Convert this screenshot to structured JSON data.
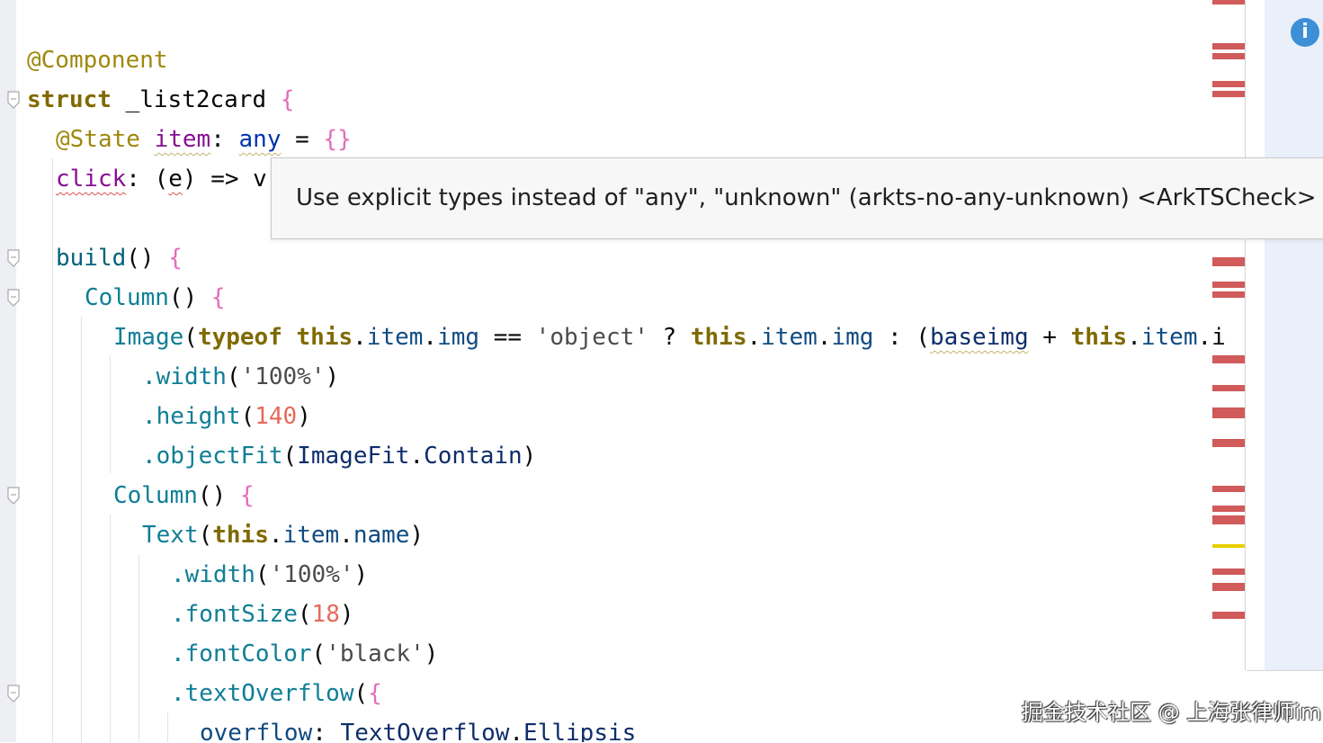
{
  "editor": {
    "lines": [
      {
        "id": "l1",
        "tokens": [
          {
            "c": "dec",
            "t": "@Component"
          }
        ]
      },
      {
        "id": "l2",
        "tokens": [
          {
            "c": "kw",
            "t": "struct"
          },
          {
            "c": "pn",
            "t": " _list2card "
          },
          {
            "c": "br",
            "t": "{"
          }
        ]
      },
      {
        "id": "l3",
        "tokens": [
          {
            "c": "dec",
            "t": "@State"
          },
          {
            "c": "pn",
            "t": " "
          },
          {
            "c": "pr wavy",
            "t": "item"
          },
          {
            "c": "pn",
            "t": ": "
          },
          {
            "c": "k wavy",
            "t": "any"
          },
          {
            "c": "pn",
            "t": " = "
          },
          {
            "c": "br",
            "t": "{}"
          }
        ]
      },
      {
        "id": "l4",
        "tokens": [
          {
            "c": "pr wavyr",
            "t": "click"
          },
          {
            "c": "pn",
            "t": ": ("
          },
          {
            "c": "pn wavyr",
            "t": "e"
          },
          {
            "c": "pn",
            "t": ") => v"
          }
        ]
      },
      {
        "id": "l5",
        "tokens": []
      },
      {
        "id": "l6",
        "tokens": [
          {
            "c": "call",
            "t": "build"
          },
          {
            "c": "pn",
            "t": "() "
          },
          {
            "c": "br",
            "t": "{"
          }
        ]
      },
      {
        "id": "l7",
        "tokens": [
          {
            "c": "m",
            "t": "Column"
          },
          {
            "c": "pn",
            "t": "() "
          },
          {
            "c": "br",
            "t": "{"
          }
        ]
      },
      {
        "id": "l8",
        "tokens": [
          {
            "c": "m",
            "t": "Image"
          },
          {
            "c": "pn",
            "t": "("
          },
          {
            "c": "kw",
            "t": "typeof"
          },
          {
            "c": "pn",
            "t": " "
          },
          {
            "c": "kw",
            "t": "this"
          },
          {
            "c": "pn",
            "t": "."
          },
          {
            "c": "prop",
            "t": "item"
          },
          {
            "c": "pn",
            "t": "."
          },
          {
            "c": "prop",
            "t": "img"
          },
          {
            "c": "pn",
            "t": " == "
          },
          {
            "c": "str",
            "t": "'object'"
          },
          {
            "c": "pn",
            "t": " ? "
          },
          {
            "c": "kw",
            "t": "this"
          },
          {
            "c": "pn",
            "t": "."
          },
          {
            "c": "prop",
            "t": "item"
          },
          {
            "c": "pn",
            "t": "."
          },
          {
            "c": "prop",
            "t": "img"
          },
          {
            "c": "pn",
            "t": " : ("
          },
          {
            "c": "ty wavy",
            "t": "baseimg"
          },
          {
            "c": "pn",
            "t": " + "
          },
          {
            "c": "kw",
            "t": "this"
          },
          {
            "c": "pn",
            "t": "."
          },
          {
            "c": "prop",
            "t": "item"
          },
          {
            "c": "pn",
            "t": ".i"
          }
        ]
      },
      {
        "id": "l9",
        "tokens": [
          {
            "c": "m",
            "t": ".width"
          },
          {
            "c": "pn",
            "t": "("
          },
          {
            "c": "str",
            "t": "'100%'"
          },
          {
            "c": "pn",
            "t": ")"
          }
        ]
      },
      {
        "id": "l10",
        "tokens": [
          {
            "c": "m",
            "t": ".height"
          },
          {
            "c": "pn",
            "t": "("
          },
          {
            "c": "num",
            "t": "140"
          },
          {
            "c": "pn",
            "t": ")"
          }
        ]
      },
      {
        "id": "l11",
        "tokens": [
          {
            "c": "m",
            "t": ".objectFit"
          },
          {
            "c": "pn",
            "t": "("
          },
          {
            "c": "ty",
            "t": "ImageFit"
          },
          {
            "c": "pn",
            "t": "."
          },
          {
            "c": "ty",
            "t": "Contain"
          },
          {
            "c": "pn",
            "t": ")"
          }
        ]
      },
      {
        "id": "l12",
        "tokens": [
          {
            "c": "m",
            "t": "Column"
          },
          {
            "c": "pn",
            "t": "() "
          },
          {
            "c": "br",
            "t": "{"
          }
        ]
      },
      {
        "id": "l13",
        "tokens": [
          {
            "c": "m",
            "t": "Text"
          },
          {
            "c": "pn",
            "t": "("
          },
          {
            "c": "kw",
            "t": "this"
          },
          {
            "c": "pn",
            "t": "."
          },
          {
            "c": "prop",
            "t": "item"
          },
          {
            "c": "pn",
            "t": "."
          },
          {
            "c": "prop",
            "t": "name"
          },
          {
            "c": "pn",
            "t": ")"
          }
        ]
      },
      {
        "id": "l14",
        "tokens": [
          {
            "c": "m",
            "t": ".width"
          },
          {
            "c": "pn",
            "t": "("
          },
          {
            "c": "str",
            "t": "'100%'"
          },
          {
            "c": "pn",
            "t": ")"
          }
        ]
      },
      {
        "id": "l15",
        "tokens": [
          {
            "c": "m",
            "t": ".fontSize"
          },
          {
            "c": "pn",
            "t": "("
          },
          {
            "c": "num",
            "t": "18"
          },
          {
            "c": "pn",
            "t": ")"
          }
        ]
      },
      {
        "id": "l16",
        "tokens": [
          {
            "c": "m",
            "t": ".fontColor"
          },
          {
            "c": "pn",
            "t": "("
          },
          {
            "c": "str",
            "t": "'black'"
          },
          {
            "c": "pn",
            "t": ")"
          }
        ]
      },
      {
        "id": "l17",
        "tokens": [
          {
            "c": "m",
            "t": ".textOverflow"
          },
          {
            "c": "pn",
            "t": "("
          },
          {
            "c": "br",
            "t": "{"
          }
        ]
      },
      {
        "id": "l18",
        "tokens": [
          {
            "c": "prop",
            "t": "overflow"
          },
          {
            "c": "pn",
            "t": ": "
          },
          {
            "c": "ty",
            "t": "TextOverflow"
          },
          {
            "c": "pn",
            "t": "."
          },
          {
            "c": "ty",
            "t": "Ellipsis"
          }
        ]
      }
    ]
  },
  "tooltip": {
    "message": "Use explicit types instead of \"any\", \"unknown\" (arkts-no-any-unknown) <ArkTSCheck>"
  },
  "inspection_icon": "info-icon",
  "watermark": "掘金技术社区 @ 上海张律师im"
}
